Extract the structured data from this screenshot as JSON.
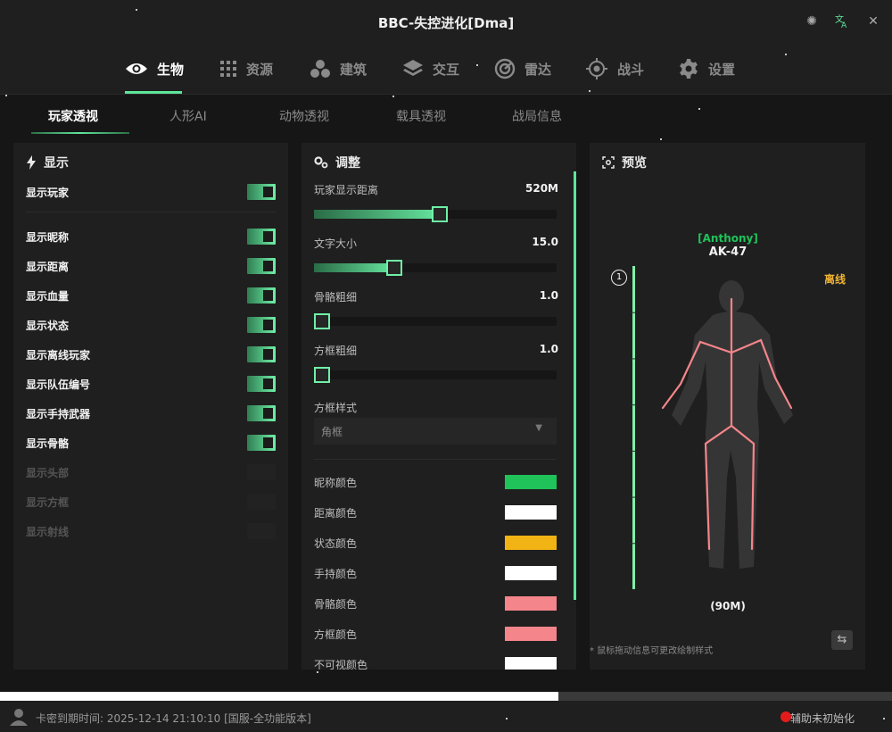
{
  "window": {
    "title": "BBC-失控进化[Dma]"
  },
  "nav": {
    "items": [
      {
        "label": "生物",
        "icon": "eye-icon",
        "active": true
      },
      {
        "label": "资源",
        "icon": "grid-icon",
        "active": false
      },
      {
        "label": "建筑",
        "icon": "spheres-icon",
        "active": false
      },
      {
        "label": "交互",
        "icon": "layers-icon",
        "active": false
      },
      {
        "label": "雷达",
        "icon": "radar-icon",
        "active": false
      },
      {
        "label": "战斗",
        "icon": "crosshair-icon",
        "active": false
      },
      {
        "label": "设置",
        "icon": "gear-icon",
        "active": false
      }
    ]
  },
  "subtabs": [
    "玩家透视",
    "人形AI",
    "动物透视",
    "载具透视",
    "战局信息"
  ],
  "display_panel": {
    "title": "显示",
    "toggles": [
      {
        "label": "显示玩家",
        "on": true
      },
      {
        "label": "显示昵称",
        "on": true
      },
      {
        "label": "显示距离",
        "on": true
      },
      {
        "label": "显示血量",
        "on": true
      },
      {
        "label": "显示状态",
        "on": true
      },
      {
        "label": "显示离线玩家",
        "on": true
      },
      {
        "label": "显示队伍编号",
        "on": true
      },
      {
        "label": "显示手持武器",
        "on": true
      },
      {
        "label": "显示骨骼",
        "on": true
      },
      {
        "label": "显示头部",
        "on": false
      },
      {
        "label": "显示方框",
        "on": false
      },
      {
        "label": "显示射线",
        "on": false
      }
    ]
  },
  "adjust_panel": {
    "title": "调整",
    "sliders": [
      {
        "label": "玩家显示距离",
        "value": "520M",
        "fraction": 0.52
      },
      {
        "label": "文字大小",
        "value": "15.0",
        "fraction": 0.32
      },
      {
        "label": "骨骼粗细",
        "value": "1.0",
        "fraction": 0.0
      },
      {
        "label": "方框粗细",
        "value": "1.0",
        "fraction": 0.0
      }
    ],
    "box_style": {
      "label": "方框样式",
      "selected": "角框"
    },
    "colors": [
      {
        "label": "昵称颜色",
        "color": "#1fc35a"
      },
      {
        "label": "距离颜色",
        "color": "#ffffff"
      },
      {
        "label": "状态颜色",
        "color": "#f2b414"
      },
      {
        "label": "手持颜色",
        "color": "#ffffff"
      },
      {
        "label": "骨骼颜色",
        "color": "#f4858a"
      },
      {
        "label": "方框颜色",
        "color": "#f4858a"
      },
      {
        "label": "不可视颜色",
        "color": "#ffffff"
      }
    ]
  },
  "preview_panel": {
    "title": "预览",
    "name": "[Anthony]",
    "weapon": "AK-47",
    "status": "离线",
    "team_badge": "1",
    "distance": "(90M)",
    "hint": "* 鼠标拖动信息可更改绘制样式",
    "health_fraction": 1.0
  },
  "progress": {
    "fraction": 0.626
  },
  "statusbar": {
    "expiry_text": "卡密到期时间: 2025-12-14 21:10:10 [国服-全功能版本]",
    "assist_status": "辅助未初始化"
  }
}
